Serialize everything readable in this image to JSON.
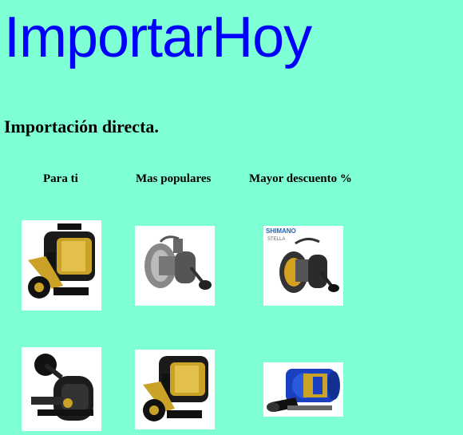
{
  "header": {
    "logo": "ImportarHoy",
    "tagline": "Importación directa."
  },
  "tabs": [
    {
      "label": "Para ti"
    },
    {
      "label": "Mas populares"
    },
    {
      "label": "Mayor descuento %"
    }
  ],
  "products": [
    {
      "icon": "conventional-reel-black-gold-icon"
    },
    {
      "icon": "spinning-reel-silver-icon"
    },
    {
      "icon": "spinning-reel-gold-icon",
      "brand": "SHIMANO",
      "model": "STELLA"
    },
    {
      "icon": "baitcasting-reel-black-icon"
    },
    {
      "icon": "conventional-reel-black-gold-icon"
    },
    {
      "icon": "conventional-reel-blue-icon"
    }
  ]
}
